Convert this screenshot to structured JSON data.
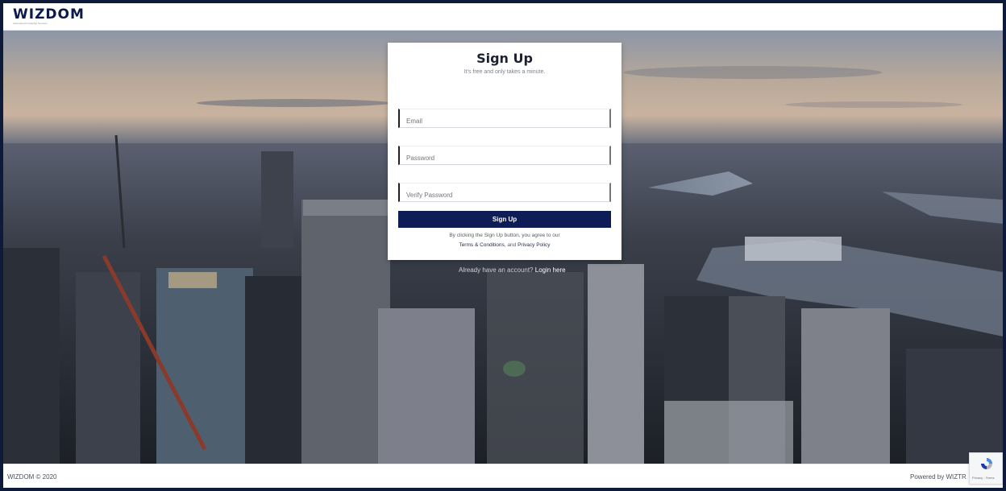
{
  "brand": {
    "logo": "WIZDOM",
    "tagline": "Automated Knowledge Services"
  },
  "signup": {
    "title": "Sign Up",
    "subtitle": "It's free and only takes a minute.",
    "email_placeholder": "Email",
    "password_placeholder": "Password",
    "verify_placeholder": "Verify Password",
    "submit_label": "Sign Up",
    "terms_prefix": "By clicking the Sign Up button, you agree to our",
    "terms_link": "Terms & Conditions",
    "terms_and": ", and",
    "privacy_link": "Privacy Policy"
  },
  "login_prompt": {
    "text": "Already have an account?",
    "link": "Login here"
  },
  "footer": {
    "copyright": "WIZDOM © 2020",
    "powered": "Powered by WIZTR"
  },
  "recaptcha": {
    "text": "Privacy - Terms",
    "icon": "recaptcha-icon"
  },
  "colors": {
    "primary": "#0e1d55",
    "frame": "#0d1a3a"
  }
}
